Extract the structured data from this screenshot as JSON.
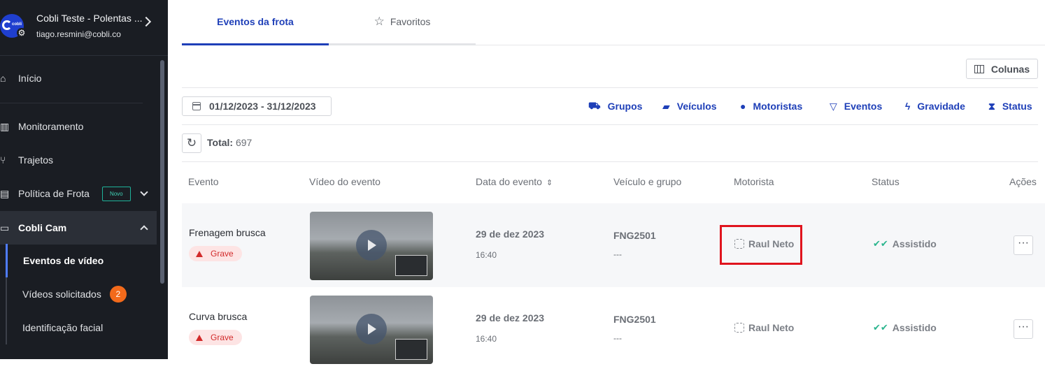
{
  "account": {
    "name": "Cobli Teste - Polentas ...",
    "email": "tiago.resmini@cobli.co",
    "logo_text": "cobli"
  },
  "sidebar": {
    "items": [
      {
        "label": "Início",
        "icon": "home-icon"
      },
      {
        "label": "Monitoramento",
        "icon": "map-icon"
      },
      {
        "label": "Trajetos",
        "icon": "route-icon"
      },
      {
        "label": "Política de Frota",
        "icon": "document-icon",
        "badge": "Novo"
      },
      {
        "label": "Cobli Cam",
        "icon": "camera-icon"
      }
    ],
    "subitems": [
      {
        "label": "Eventos de vídeo"
      },
      {
        "label": "Vídeos solicitados",
        "count": "2"
      },
      {
        "label": "Identificação facial"
      }
    ]
  },
  "tabs": [
    {
      "label": "Eventos da frota"
    },
    {
      "label": "Favoritos"
    }
  ],
  "toolbar": {
    "columns_label": "Colunas",
    "date_range": "01/12/2023 - 31/12/2023",
    "filters": [
      "Grupos",
      "Veículos",
      "Motoristas",
      "Eventos",
      "Gravidade",
      "Status"
    ],
    "total_label": "Total:",
    "total_value": "697"
  },
  "table": {
    "headers": [
      "Evento",
      "Vídeo do evento",
      "Data do evento",
      "Veículo e grupo",
      "Motorista",
      "Status",
      "Ações"
    ],
    "rows": [
      {
        "event": "Frenagem brusca",
        "severity": "Grave",
        "date": "29 de dez 2023",
        "time": "16:40",
        "vehicle": "FNG2501",
        "group": "---",
        "driver": "Raul Neto",
        "status": "Assistido"
      },
      {
        "event": "Curva brusca",
        "severity": "Grave",
        "date": "29 de dez 2023",
        "time": "16:40",
        "vehicle": "FNG2501",
        "group": "---",
        "driver": "Raul Neto",
        "status": "Assistido"
      }
    ]
  },
  "colors": {
    "accent": "#1e3fb8",
    "sidebar_bg": "#1a1d23",
    "severity": "#d22a2a",
    "status_ok": "#2bb58e",
    "badge": "#f26a1b"
  }
}
